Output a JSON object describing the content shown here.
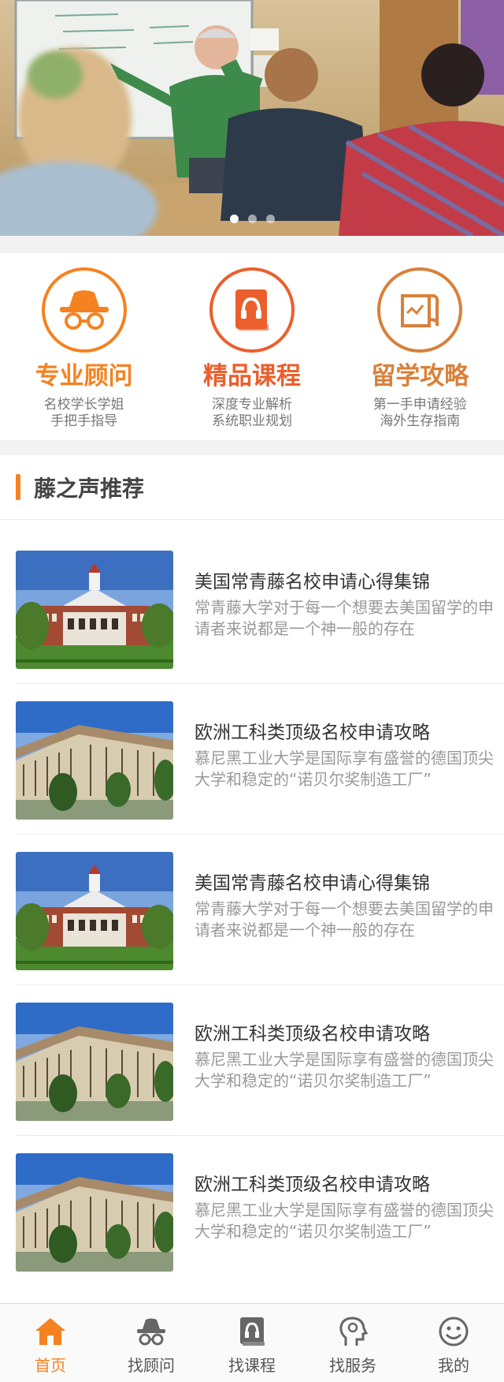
{
  "banner": {
    "slides": 3,
    "active_slide": 1
  },
  "features": [
    {
      "title": "专业顾问",
      "line1": "名校学长学姐",
      "line2": "手把手指导",
      "icon": "advisor-glasses-icon",
      "color": "#f58220"
    },
    {
      "title": "精品课程",
      "line1": "深度专业解析",
      "line2": "系统职业规划",
      "icon": "course-book-icon",
      "color": "#ea5f2c"
    },
    {
      "title": "留学攻略",
      "line1": "第一手申请经验",
      "line2": "海外生存指南",
      "icon": "guide-map-icon",
      "color": "#d9803a"
    }
  ],
  "recommend": {
    "title": "藤之声推荐",
    "articles": [
      {
        "title": "美国常青藤名校申请心得集锦",
        "desc": "常青藤大学对于每一个想要去美国留学的申请者来说都是一个神一般的存在",
        "image": "red-brick-campus-photo"
      },
      {
        "title": "欧洲工科类顶级名校申请攻略",
        "desc": "慕尼黑工业大学是国际享有盛誉的德国顶尖大学和稳定的“诺贝尔奖制造工厂”",
        "image": "stone-university-building-photo"
      },
      {
        "title": "美国常青藤名校申请心得集锦",
        "desc": "常青藤大学对于每一个想要去美国留学的申请者来说都是一个神一般的存在",
        "image": "red-brick-campus-photo"
      },
      {
        "title": "欧洲工科类顶级名校申请攻略",
        "desc": "慕尼黑工业大学是国际享有盛誉的德国顶尖大学和稳定的“诺贝尔奖制造工厂”",
        "image": "stone-university-building-photo"
      },
      {
        "title": "欧洲工科类顶级名校申请攻略",
        "desc": "慕尼黑工业大学是国际享有盛誉的德国顶尖大学和稳定的“诺贝尔奖制造工厂”",
        "image": "stone-university-building-photo"
      }
    ]
  },
  "tabbar": {
    "active": 0,
    "items": [
      {
        "label": "首页",
        "icon": "home-icon"
      },
      {
        "label": "找顾问",
        "icon": "advisor-icon"
      },
      {
        "label": "找课程",
        "icon": "course-icon"
      },
      {
        "label": "找服务",
        "icon": "service-icon"
      },
      {
        "label": "我的",
        "icon": "profile-icon"
      }
    ]
  },
  "colors": {
    "accent": "#f58220",
    "accent_red": "#ea5f2c",
    "accent_brown": "#d9803a"
  }
}
